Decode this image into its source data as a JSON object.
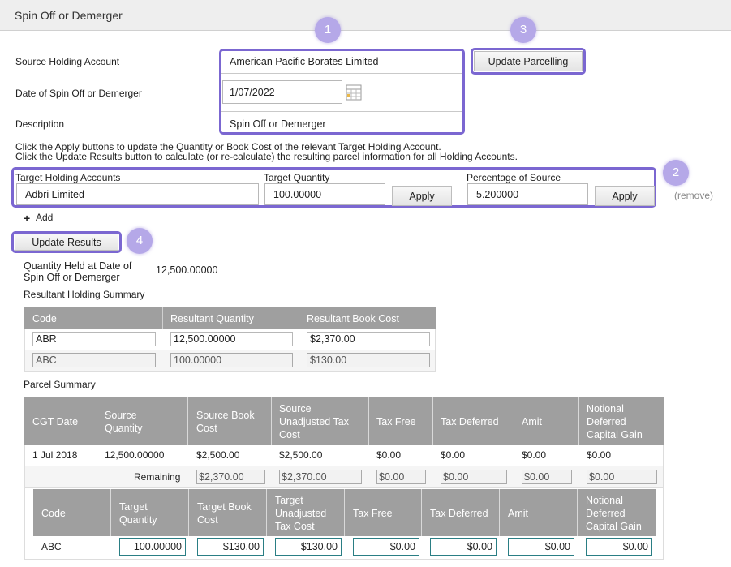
{
  "page": {
    "title": "Spin Off or Demerger"
  },
  "form": {
    "source_label": "Source Holding Account",
    "source_value": "American Pacific Borates Limited",
    "date_label": "Date of Spin Off or Demerger",
    "date_value": "1/07/2022",
    "desc_label": "Description",
    "desc_value": "Spin Off or Demerger",
    "update_parcelling": "Update Parcelling"
  },
  "instructions": {
    "line1": "Click the Apply buttons to update the Quantity or Book Cost of the relevant Target Holding Account.",
    "line2": "Click the Update Results button to calculate (or re-calculate) the resulting parcel information for all Holding Accounts."
  },
  "target": {
    "accounts_label": "Target Holding Accounts",
    "quantity_label": "Target Quantity",
    "percent_label": "Percentage of Source",
    "account_value": "Adbri Limited",
    "quantity_value": "100.00000",
    "percent_value": "5.200000",
    "apply1": "Apply",
    "apply2": "Apply",
    "remove": "(remove)",
    "add": "Add",
    "add_icon": "+"
  },
  "update_results": "Update Results",
  "badges": [
    "1",
    "2",
    "3",
    "4"
  ],
  "quantity_held": {
    "label_line1": "Quantity Held at Date of",
    "label_line2": "Spin Off or Demerger",
    "value": "12,500.00000"
  },
  "resultant": {
    "title": "Resultant Holding Summary",
    "headers": [
      "Code",
      "Resultant Quantity",
      "Resultant Book Cost"
    ],
    "rows": [
      [
        "ABR",
        "12,500.00000",
        "$2,370.00"
      ],
      [
        "ABC",
        "100.00000",
        "$130.00"
      ]
    ]
  },
  "parcel": {
    "title": "Parcel Summary",
    "headers": [
      [
        "CGT Date"
      ],
      [
        "Source",
        "Quantity"
      ],
      [
        "Source Book",
        "Cost"
      ],
      [
        "Source",
        "Unadjusted Tax",
        "Cost"
      ],
      [
        "Tax Free"
      ],
      [
        "Tax Deferred"
      ],
      [
        "Amit"
      ],
      [
        "Notional",
        "Deferred",
        "Capital Gain"
      ]
    ],
    "row": [
      "1 Jul 2018",
      "12,500.00000",
      "$2,500.00",
      "$2,500.00",
      "$0.00",
      "$0.00",
      "$0.00",
      "$0.00"
    ],
    "remaining_label": "Remaining",
    "remaining": [
      "$2,370.00",
      "$2,370.00",
      "$0.00",
      "$0.00",
      "$0.00",
      "$0.00"
    ],
    "sub_headers": [
      [
        "Code"
      ],
      [
        "Target",
        "Quantity"
      ],
      [
        "Target Book",
        "Cost"
      ],
      [
        "Target",
        "Unadjusted",
        "Tax Cost"
      ],
      [
        "Tax Free"
      ],
      [
        "Tax Deferred"
      ],
      [
        "Amit"
      ],
      [
        "Notional",
        "Deferred",
        "Capital Gain"
      ]
    ],
    "sub_row": [
      "ABC",
      "100.00000",
      "$130.00",
      "$130.00",
      "$0.00",
      "$0.00",
      "$0.00",
      "$0.00"
    ]
  },
  "colors": {
    "accent": "#7b67d1",
    "badge": "#b5a8e8",
    "table_header": "#9f9f9f"
  },
  "icons": {
    "calendar": "calendar-icon"
  }
}
